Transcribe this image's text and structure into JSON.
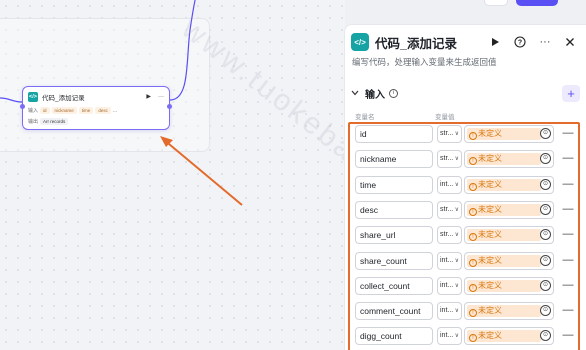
{
  "colors": {
    "accent": "#5a4ff3",
    "node_border": "#7b6cf6",
    "code_icon": "#15a3a3",
    "undefined_tag_bg": "#fde6d2",
    "undefined_tag_text": "#d9770a",
    "highlight": "#e36b2c"
  },
  "watermark": "www.tuokebao.net",
  "node": {
    "icon": "</>",
    "title": "代码_添加记录",
    "input_label": "输入",
    "inputs": [
      "id",
      "nickname",
      "time",
      "desc"
    ],
    "input_more": "...",
    "output_label": "输出",
    "output_value": "Arr records"
  },
  "panel": {
    "icon": "</>",
    "title": "代码_添加记录",
    "description": "编写代码，处理输入变量来生成返回值",
    "header_icons": [
      "play-icon",
      "help-icon",
      "more-icon",
      "close-icon"
    ],
    "input_section": {
      "title": "输入",
      "add_button": "+"
    },
    "columns": {
      "name": "变量名",
      "value": "变量值"
    },
    "params": [
      {
        "name": "id",
        "type": "str...",
        "value": "未定义"
      },
      {
        "name": "nickname",
        "type": "str...",
        "value": "未定义"
      },
      {
        "name": "time",
        "type": "int...",
        "value": "未定义"
      },
      {
        "name": "desc",
        "type": "str...",
        "value": "未定义"
      },
      {
        "name": "share_url",
        "type": "str...",
        "value": "未定义"
      },
      {
        "name": "share_count",
        "type": "int...",
        "value": "未定义"
      },
      {
        "name": "collect_count",
        "type": "int...",
        "value": "未定义"
      },
      {
        "name": "comment_count",
        "type": "int...",
        "value": "未定义"
      },
      {
        "name": "digg_count",
        "type": "int...",
        "value": "未定义"
      }
    ]
  }
}
